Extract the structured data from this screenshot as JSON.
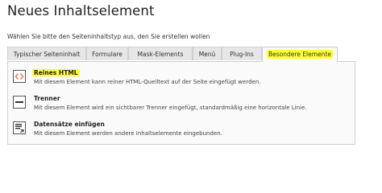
{
  "page": {
    "title": "Neues Inhaltselement",
    "subtitle": "Wählen Sie bitte den Seiteninhaltstyp aus, den Sie erstellen wollen"
  },
  "tabs": [
    {
      "label": "Typischer Seiteninhalt",
      "active": false
    },
    {
      "label": "Formulare",
      "active": false
    },
    {
      "label": "Mask-Elements",
      "active": false
    },
    {
      "label": "Menü",
      "active": false
    },
    {
      "label": "Plug-Ins",
      "active": false
    },
    {
      "label": "Besondere Elemente",
      "active": true
    }
  ],
  "elements": [
    {
      "title": "Reines HTML",
      "description": "Mit diesem Element kann reiner HTML-Quelltext auf der Seite eingefügt werden.",
      "icon": "html-code-icon",
      "highlighted": true
    },
    {
      "title": "Trenner",
      "description": "Mit diesem Element wird ein sichtbarer Trenner eingefügt, standardmäßig eine horizontale Linie.",
      "icon": "divider-icon",
      "highlighted": false
    },
    {
      "title": "Datensätze einfügen",
      "description": "Mit diesem Element werden andere Inhaltselemente eingebunden.",
      "icon": "insert-records-icon",
      "highlighted": false
    }
  ],
  "colors": {
    "highlight": "#ffff33",
    "html_icon_accent": "#e8743b",
    "tab_background": "#e6e6e6",
    "panel_background": "#fafafa",
    "border": "#cfcfcf"
  }
}
